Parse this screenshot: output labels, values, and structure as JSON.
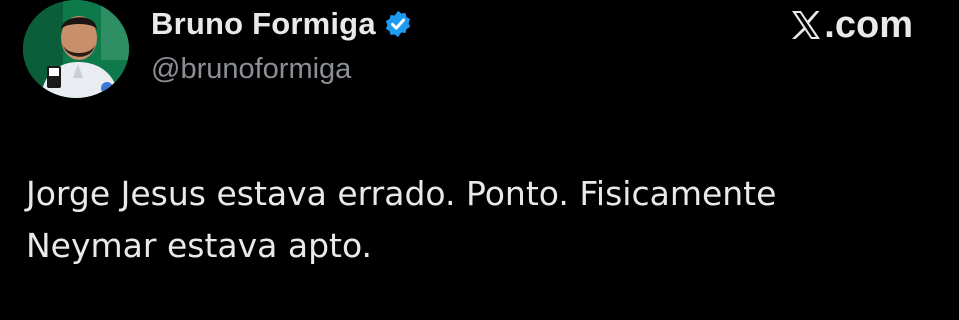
{
  "author": {
    "display_name": "Bruno Formiga",
    "handle": "@brunoformiga",
    "verified": true,
    "avatar_icon": "person-avatar-photo"
  },
  "site": {
    "logo_letter": "X",
    "suffix": ".com",
    "logo_icon": "x-logo-icon"
  },
  "tweet": {
    "lines": [
      "Jorge Jesus estava errado. Ponto. Fisicamente",
      "Neymar estava apto."
    ]
  },
  "colors": {
    "background": "#000000",
    "primary_text": "#e7e9ea",
    "secondary_text": "#8b8f94",
    "verified_badge": "#1d9bf0"
  }
}
